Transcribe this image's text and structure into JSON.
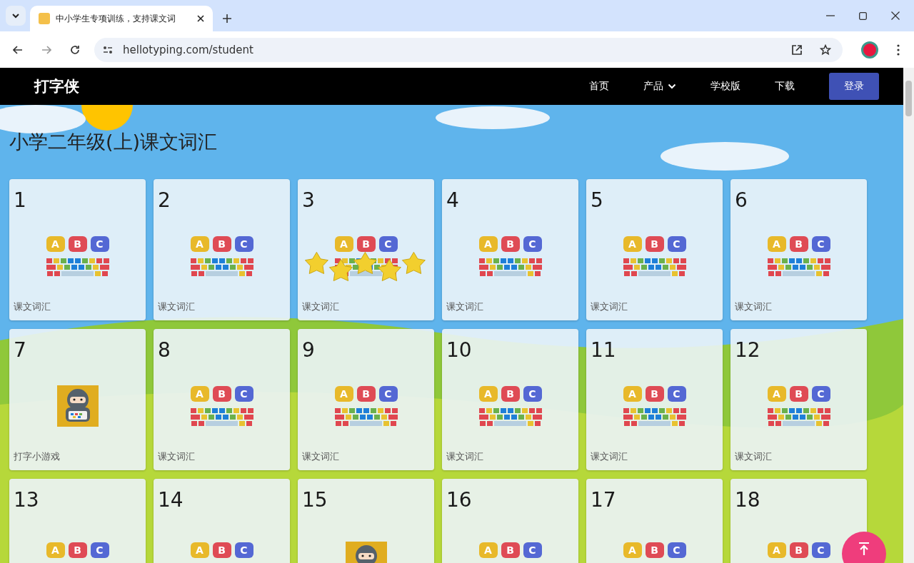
{
  "browser": {
    "tab_title": "中小学生专项训练，支持课文词",
    "url": "hellotyping.com/student"
  },
  "site_nav": {
    "logo": "打字侠",
    "links": [
      {
        "label": "首页",
        "dropdown": false
      },
      {
        "label": "产品",
        "dropdown": true
      },
      {
        "label": "学校版",
        "dropdown": false
      },
      {
        "label": "下载",
        "dropdown": false
      }
    ],
    "login": "登录"
  },
  "page_title": "小学二年级(上)课文词汇",
  "cards": [
    {
      "number": "1",
      "kind": "keyboard",
      "letters": [
        "A",
        "B",
        "C"
      ],
      "completed": false,
      "label": "课文词汇"
    },
    {
      "number": "2",
      "kind": "keyboard",
      "letters": [
        "A",
        "B",
        "C"
      ],
      "completed": false,
      "label": "课文词汇"
    },
    {
      "number": "3",
      "kind": "keyboard",
      "letters": [
        "A",
        "B",
        "C"
      ],
      "completed": true,
      "label": "课文词汇"
    },
    {
      "number": "4",
      "kind": "keyboard",
      "letters": [
        "A",
        "B",
        "C"
      ],
      "completed": false,
      "label": "课文词汇"
    },
    {
      "number": "5",
      "kind": "keyboard",
      "letters": [
        "A",
        "B",
        "C"
      ],
      "completed": false,
      "label": "课文词汇"
    },
    {
      "number": "6",
      "kind": "keyboard",
      "letters": [
        "A",
        "B",
        "C"
      ],
      "completed": false,
      "label": "课文词汇"
    },
    {
      "number": "7",
      "kind": "game",
      "completed": false,
      "label": "打字小游戏"
    },
    {
      "number": "8",
      "kind": "keyboard",
      "letters": [
        "A",
        "B",
        "C"
      ],
      "completed": false,
      "label": "课文词汇"
    },
    {
      "number": "9",
      "kind": "keyboard",
      "letters": [
        "A",
        "B",
        "C"
      ],
      "completed": false,
      "label": "课文词汇"
    },
    {
      "number": "10",
      "kind": "keyboard",
      "letters": [
        "A",
        "B",
        "C"
      ],
      "completed": false,
      "label": "课文词汇"
    },
    {
      "number": "11",
      "kind": "keyboard",
      "letters": [
        "A",
        "B",
        "C"
      ],
      "completed": false,
      "label": "课文词汇"
    },
    {
      "number": "12",
      "kind": "keyboard",
      "letters": [
        "A",
        "B",
        "C"
      ],
      "completed": false,
      "label": "课文词汇"
    },
    {
      "number": "13",
      "kind": "keyboard",
      "letters": [
        "A",
        "B",
        "C"
      ],
      "completed": false
    },
    {
      "number": "14",
      "kind": "keyboard",
      "letters": [
        "A",
        "B",
        "C"
      ],
      "completed": false
    },
    {
      "number": "15",
      "kind": "game",
      "completed": false
    },
    {
      "number": "16",
      "kind": "keyboard",
      "letters": [
        "A",
        "B",
        "C"
      ],
      "completed": false
    },
    {
      "number": "17",
      "kind": "keyboard",
      "letters": [
        "A",
        "B",
        "C"
      ],
      "completed": false
    },
    {
      "number": "18",
      "kind": "keyboard",
      "letters": [
        "A",
        "B",
        "C"
      ],
      "completed": false
    }
  ]
}
